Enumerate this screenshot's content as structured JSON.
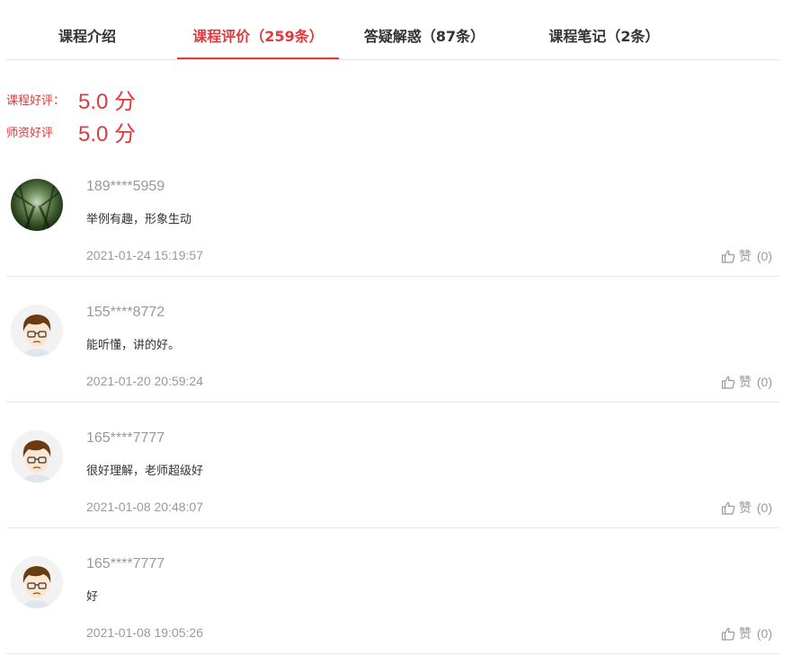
{
  "tabs": [
    {
      "label": "课程介绍",
      "active": false
    },
    {
      "label": "课程评价（259条）",
      "active": true
    },
    {
      "label": "答疑解惑（87条）",
      "active": false
    },
    {
      "label": "课程笔记（2条）",
      "active": false
    }
  ],
  "scores": {
    "course": {
      "label": "课程好评：",
      "value": "5.0 分"
    },
    "teacher": {
      "label": "师资好评",
      "value": "5.0 分"
    }
  },
  "colors": {
    "accent": "#e1393c",
    "muted": "#999999",
    "divider": "#e8e8e8"
  },
  "comments": [
    {
      "user": "189****5959",
      "avatar": "forest-photo",
      "content": "举例有趣，形象生动",
      "time": "2021-01-24 15:19:57",
      "like_label": "赞",
      "like_count": "(0)"
    },
    {
      "user": "155****8772",
      "avatar": "cartoon-boy",
      "content": "能听懂，讲的好。",
      "time": "2021-01-20 20:59:24",
      "like_label": "赞",
      "like_count": "(0)"
    },
    {
      "user": "165****7777",
      "avatar": "cartoon-boy",
      "content": "很好理解，老师超级好",
      "time": "2021-01-08 20:48:07",
      "like_label": "赞",
      "like_count": "(0)"
    },
    {
      "user": "165****7777",
      "avatar": "cartoon-boy",
      "content": "好",
      "time": "2021-01-08 19:05:26",
      "like_label": "赞",
      "like_count": "(0)"
    }
  ]
}
